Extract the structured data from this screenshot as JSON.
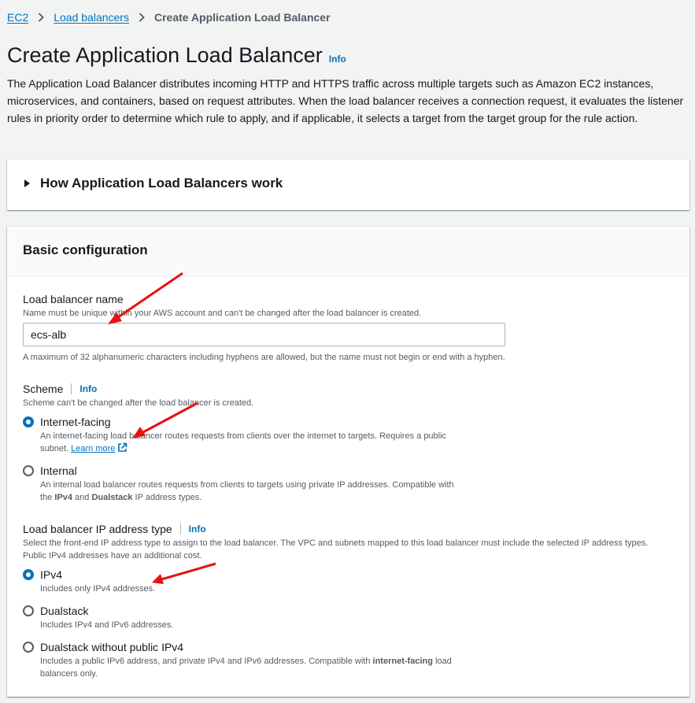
{
  "breadcrumb": {
    "items": [
      "EC2",
      "Load balancers"
    ],
    "current": "Create Application Load Balancer"
  },
  "header": {
    "title": "Create Application Load Balancer",
    "info": "Info",
    "description": "The Application Load Balancer distributes incoming HTTP and HTTPS traffic across multiple targets such as Amazon EC2 instances, microservices, and containers, based on request attributes. When the load balancer receives a connection request, it evaluates the listener rules in priority order to determine which rule to apply, and if applicable, it selects a target from the target group for the rule action."
  },
  "how_it_works": {
    "label": "How Application Load Balancers work"
  },
  "basic_config": {
    "title": "Basic configuration",
    "name": {
      "label": "Load balancer name",
      "description": "Name must be unique within your AWS account and can't be changed after the load balancer is created.",
      "value": "ecs-alb",
      "constraint": "A maximum of 32 alphanumeric characters including hyphens are allowed, but the name must not begin or end with a hyphen."
    },
    "scheme": {
      "label": "Scheme",
      "info": "Info",
      "description": "Scheme can't be changed after the load balancer is created.",
      "selected": "Internet-facing",
      "options": [
        {
          "label": "Internet-facing",
          "desc_line1": "An internet-facing load balancer routes requests from clients over the internet to targets. Requires a public",
          "desc_line2": "subnet.",
          "link": "Learn more"
        },
        {
          "label": "Internal",
          "desc_line1": "An internal load balancer routes requests from clients to targets using private IP addresses. Compatible with",
          "desc_pre": "the ",
          "desc_b1": "IPv4",
          "desc_mid": " and ",
          "desc_b2": "Dualstack",
          "desc_post": " IP address types."
        }
      ]
    },
    "ip_type": {
      "label": "Load balancer IP address type",
      "info": "Info",
      "description": "Select the front-end IP address type to assign to the load balancer. The VPC and subnets mapped to this load balancer must include the selected IP address types. Public IPv4 addresses have an additional cost.",
      "selected": "IPv4",
      "options": [
        {
          "label": "IPv4",
          "desc": "Includes only IPv4 addresses."
        },
        {
          "label": "Dualstack",
          "desc": "Includes IPv4 and IPv6 addresses."
        },
        {
          "label": "Dualstack without public IPv4",
          "desc_pre": "Includes a public IPv6 address, and private IPv4 and IPv6 addresses. Compatible with ",
          "desc_b": "internet-facing",
          "desc_post": " load",
          "desc_line2": "balancers only."
        }
      ]
    }
  },
  "colors": {
    "link": "#0073bb",
    "annotation_arrow": "#e8110f",
    "background": "#f2f3f3"
  }
}
